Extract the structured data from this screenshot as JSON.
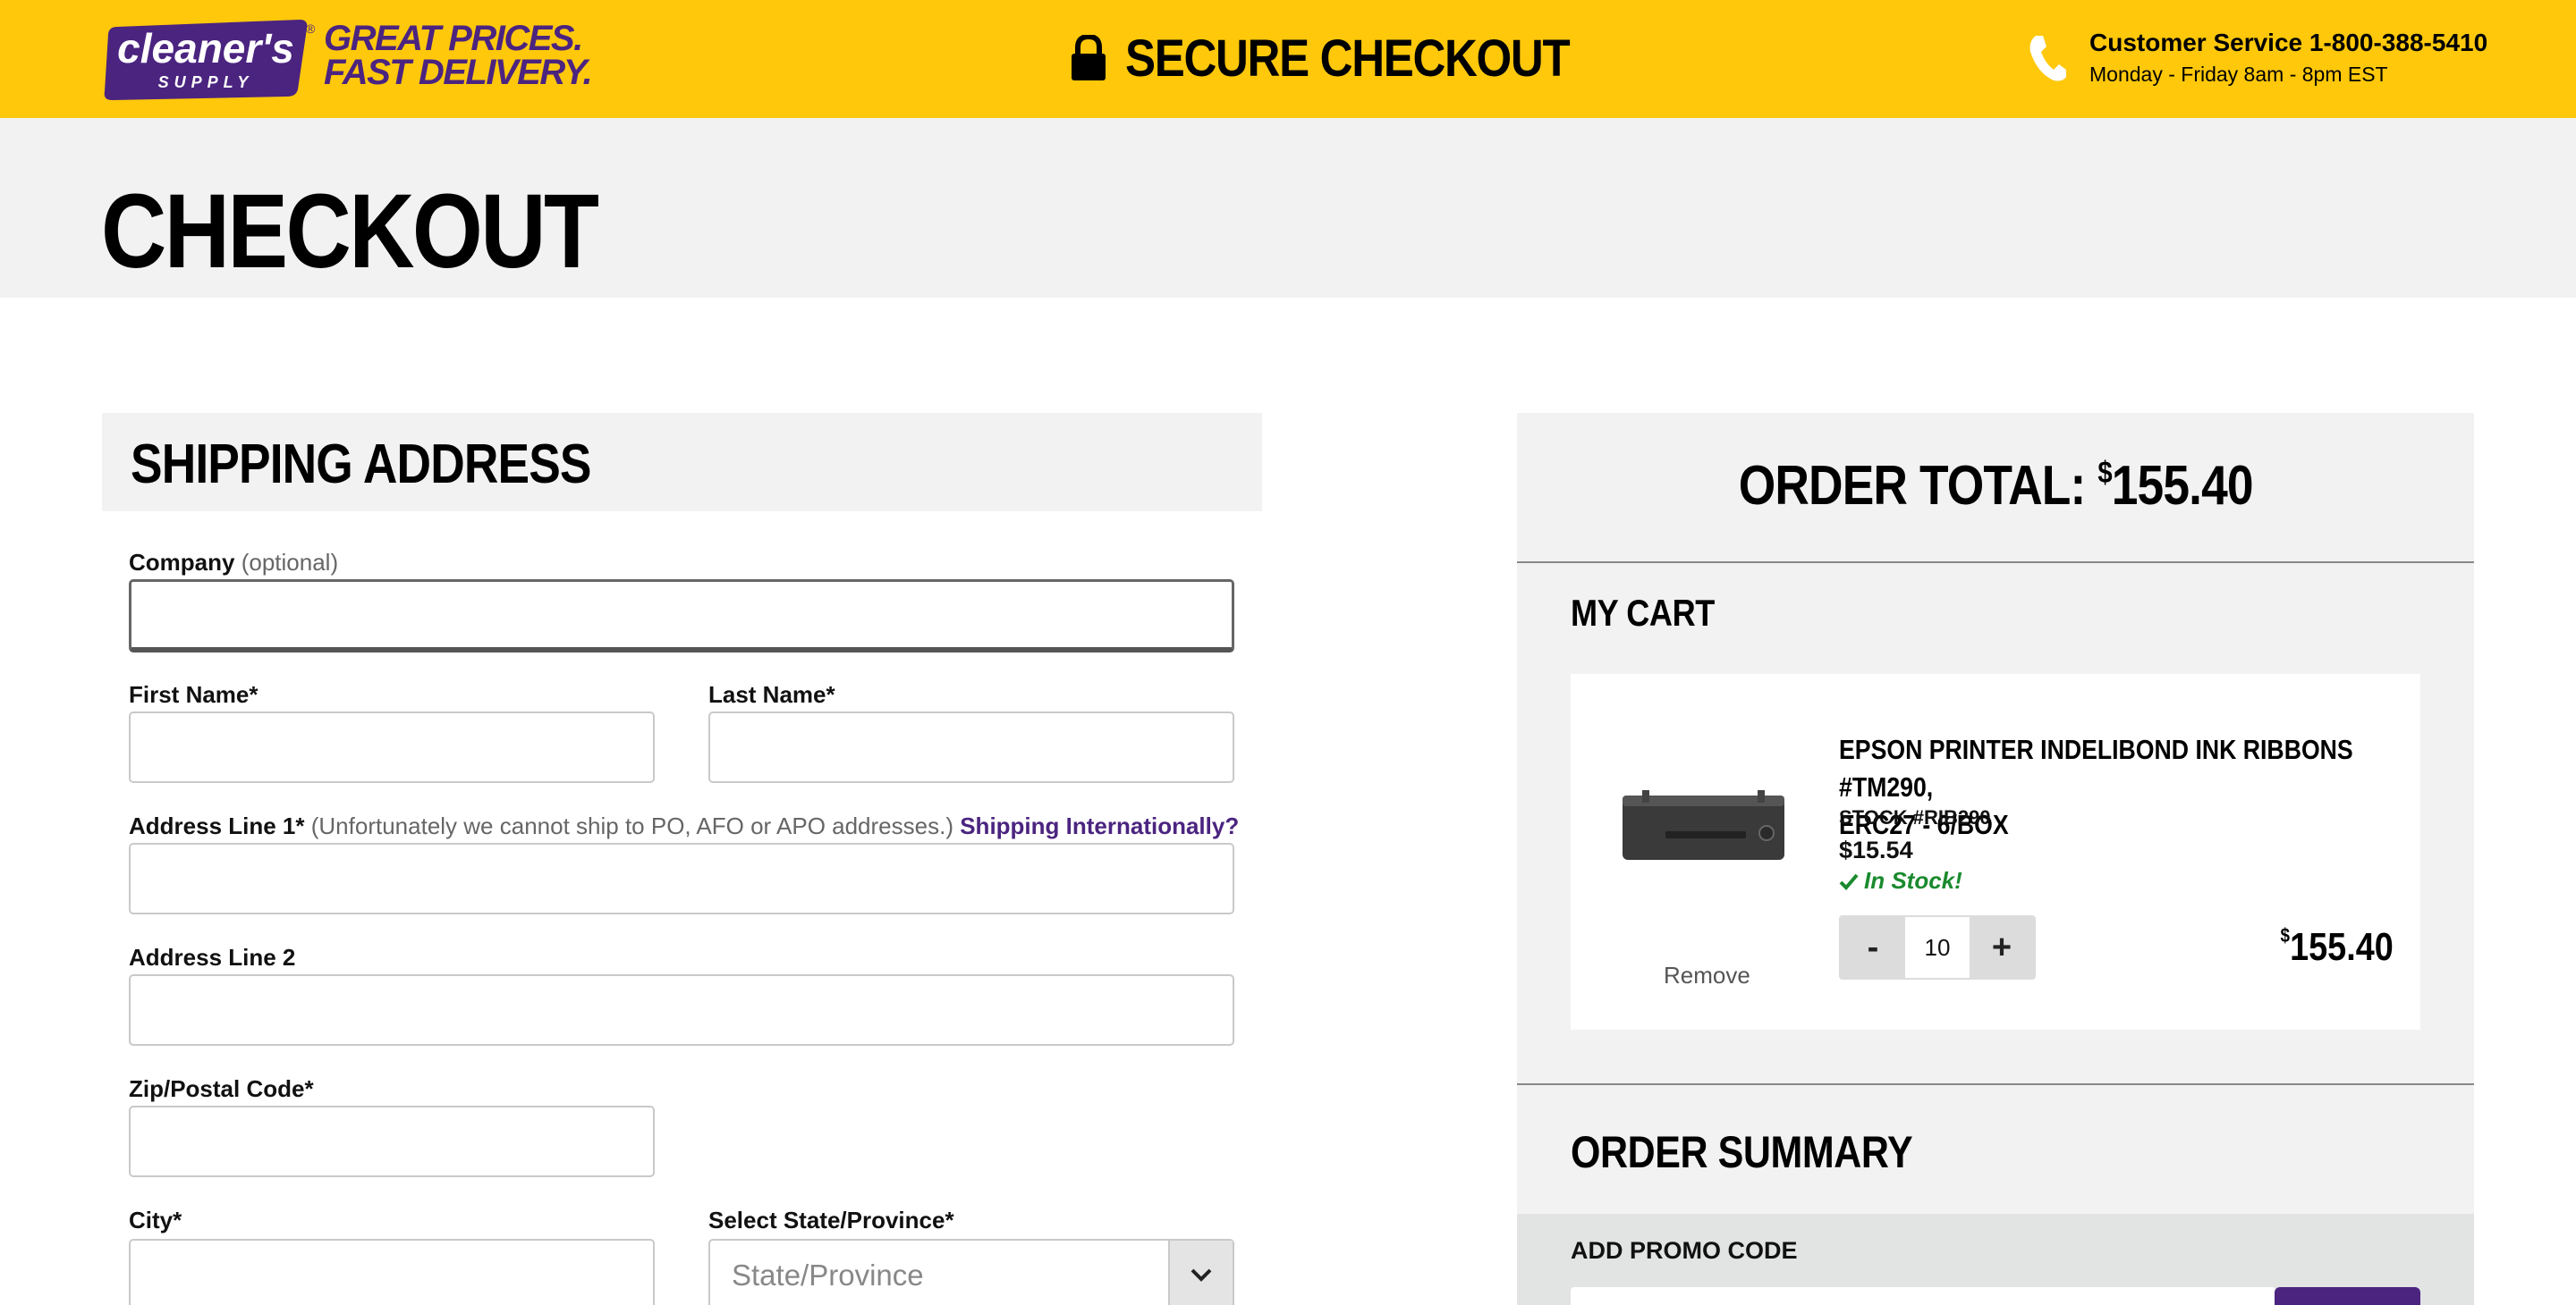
{
  "header": {
    "logo_text": "cleaner's",
    "logo_subtext": "SUPPLY",
    "logo_reg": "®",
    "tagline_line1": "GREAT PRICES.",
    "tagline_line2": "FAST DELIVERY.",
    "secure_checkout": "SECURE CHECKOUT",
    "customer_service": "Customer Service 1-800-388-5410",
    "hours": "Monday - Friday 8am - 8pm EST",
    "icons": {
      "lock": "lock-icon",
      "phone": "phone-icon"
    },
    "brand_yellow": "#FFC80B",
    "brand_purple": "#4B2480"
  },
  "page": {
    "title": "CHECKOUT"
  },
  "shipping": {
    "title": "SHIPPING ADDRESS",
    "company_label": "Company",
    "company_optional": "(optional)",
    "first_name_label": "First Name*",
    "last_name_label": "Last Name*",
    "address1_label": "Address Line 1*",
    "address1_note": "(Unfortunately we cannot ship to PO, AFO or APO addresses.)",
    "address1_intl_link": "Shipping Internationally?",
    "address2_label": "Address Line 2",
    "zip_label": "Zip/Postal Code*",
    "city_label": "City*",
    "state_label": "Select State/Province*",
    "state_placeholder": "State/Province",
    "values": {
      "company": "",
      "first_name": "",
      "last_name": "",
      "address1": "",
      "address2": "",
      "zip": "",
      "city": ""
    }
  },
  "order": {
    "total_label": "ORDER TOTAL:",
    "total_currency": "$",
    "total_amount": "155.40",
    "cart_title": "MY CART",
    "item": {
      "name_line1": "EPSON PRINTER INDELIBOND INK RIBBONS #TM290,",
      "name_line2": "ERC27 - 6/BOX",
      "stock": "STOCK #RIB290",
      "unit_price": "$15.54",
      "availability": "In Stock!",
      "availability_color": "#1A8A2E",
      "remove_label": "Remove",
      "qty_minus": "-",
      "qty_value": "10",
      "qty_plus": "+",
      "line_currency": "$",
      "line_total": "155.40"
    },
    "summary_title": "ORDER SUMMARY",
    "promo_label": "ADD PROMO CODE"
  }
}
